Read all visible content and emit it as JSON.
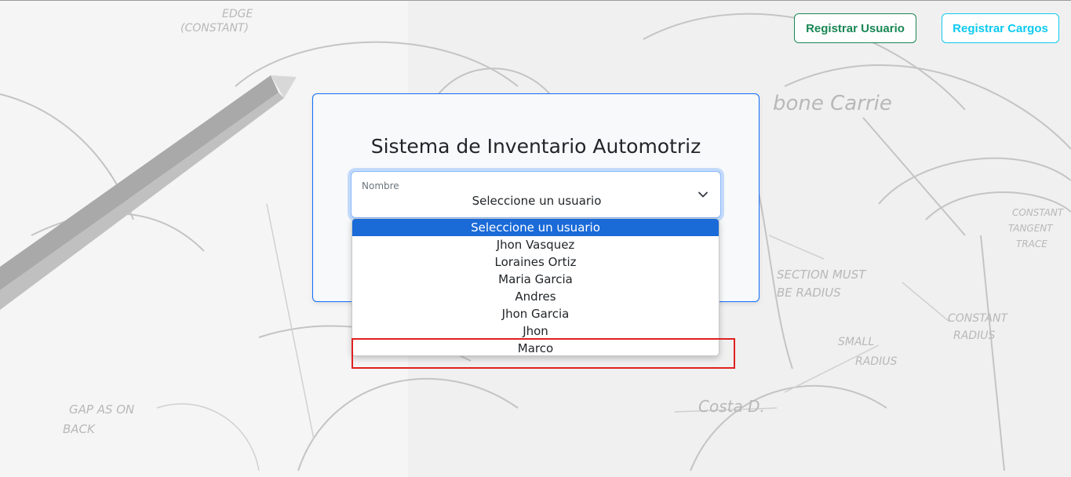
{
  "header": {
    "register_user_label": "Registrar Usuario",
    "register_positions_label": "Registrar Cargos"
  },
  "background": {
    "sketch_notes": [
      "EDGE",
      "(CONSTANT)",
      "CONSTANT TANGENT TRACE",
      "SECTION MUST",
      "BE RADIUS",
      "CONSTANT RADIUS",
      "SMALL RADIUS",
      "GAP AS ON BACK",
      "Costa D."
    ]
  },
  "card": {
    "title": "Sistema de Inventario Automotriz",
    "select": {
      "label": "Nombre",
      "value": "Seleccione un usuario",
      "icon": "chevron-down-icon"
    }
  },
  "dropdown": {
    "selected_index": 0,
    "options": [
      "Seleccione un usuario",
      "Jhon Vasquez",
      "Loraines Ortiz",
      "Maria Garcia",
      "Andres",
      "Jhon Garcia",
      "Jhon",
      "Marco"
    ]
  },
  "colors": {
    "success": "#198754",
    "info": "#0dcaf0",
    "primary": "#0d6efd",
    "option_highlight": "#1a6ad8",
    "annotation": "#e02020"
  }
}
